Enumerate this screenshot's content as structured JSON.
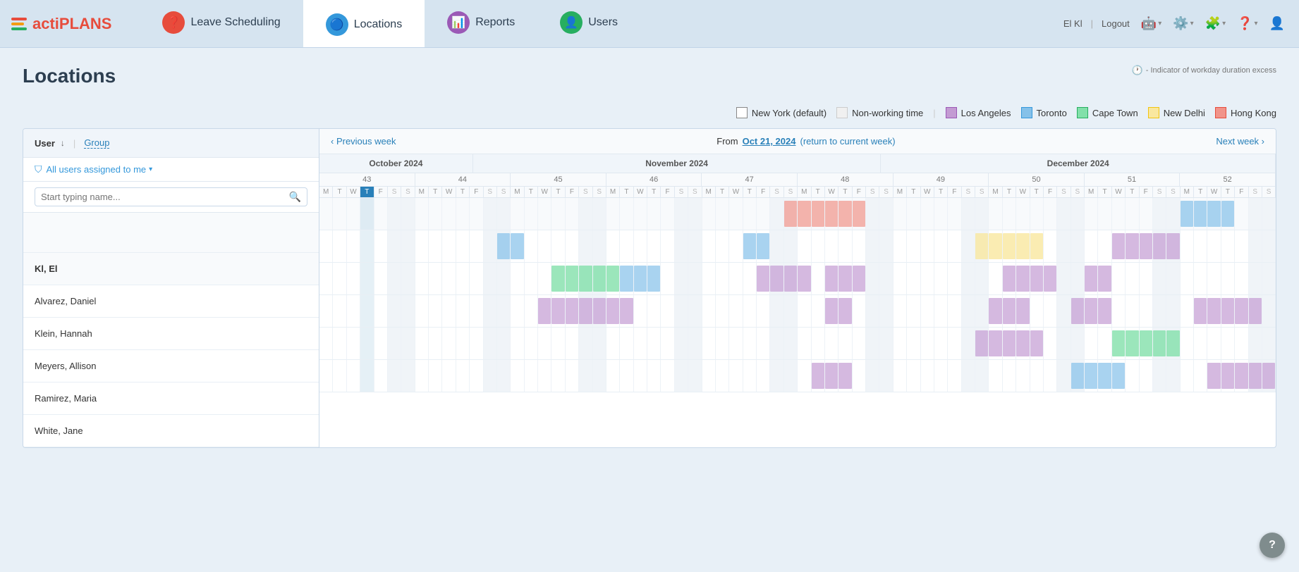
{
  "app": {
    "name_prefix": "acti",
    "name_suffix": "PLANS"
  },
  "header": {
    "user": "El Kl",
    "logout": "Logout",
    "nav": [
      {
        "id": "leave",
        "label": "Leave Scheduling",
        "icon": "❓",
        "active": false
      },
      {
        "id": "locations",
        "label": "Locations",
        "icon": "🔵",
        "active": true
      },
      {
        "id": "reports",
        "label": "Reports",
        "icon": "📊",
        "active": false
      },
      {
        "id": "users",
        "label": "Users",
        "icon": "👤",
        "active": false
      }
    ]
  },
  "page": {
    "title": "Locations",
    "indicator_text": "- Indicator of workday duration excess"
  },
  "legend": [
    {
      "id": "new-york",
      "label": "New York (default)",
      "swatch": "ny"
    },
    {
      "id": "nonworking",
      "label": "Non-working time",
      "swatch": "nonwork"
    },
    {
      "id": "los-angeles",
      "label": "Los Angeles",
      "swatch": "la"
    },
    {
      "id": "toronto",
      "label": "Toronto",
      "swatch": "toronto"
    },
    {
      "id": "cape-town",
      "label": "Cape Town",
      "swatch": "capetown"
    },
    {
      "id": "new-delhi",
      "label": "New Delhi",
      "swatch": "newdelhi"
    },
    {
      "id": "hong-kong",
      "label": "Hong Kong",
      "swatch": "hongkong"
    }
  ],
  "left_panel": {
    "user_label": "User",
    "group_label": "Group",
    "filter_label": "All users assigned to me",
    "search_placeholder": "Start typing name..."
  },
  "calendar": {
    "prev_week": "‹ Previous week",
    "next_week": "Next week ›",
    "from_label": "From",
    "date": "Oct 21, 2024",
    "return_link": "(return to current week)",
    "months": [
      {
        "label": "October 2024",
        "cols": 7
      },
      {
        "label": "November 2024",
        "cols": 28
      },
      {
        "label": "December 2024",
        "cols": 35
      }
    ]
  },
  "users": [
    {
      "id": "kl-el",
      "name": "Kl, El",
      "is_header": true
    },
    {
      "id": "alvarez-daniel",
      "name": "Alvarez, Daniel",
      "is_header": false
    },
    {
      "id": "klein-hannah",
      "name": "Klein, Hannah",
      "is_header": false
    },
    {
      "id": "meyers-allison",
      "name": "Meyers, Allison",
      "is_header": false
    },
    {
      "id": "ramirez-maria",
      "name": "Ramirez, Maria",
      "is_header": false
    },
    {
      "id": "white-jane",
      "name": "White, Jane",
      "is_header": false
    }
  ]
}
